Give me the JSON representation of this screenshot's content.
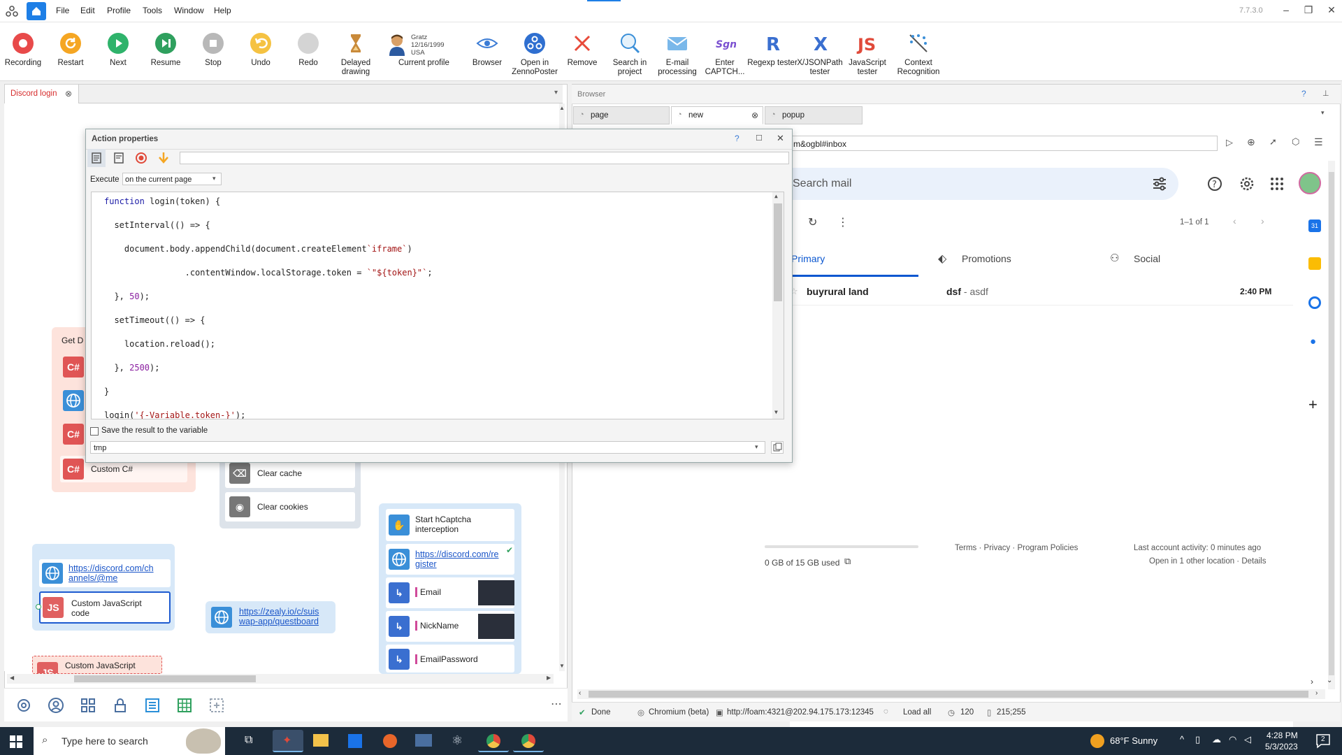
{
  "menu": {
    "file": "File",
    "edit": "Edit",
    "profile": "Profile",
    "tools": "Tools",
    "window": "Window",
    "help": "Help",
    "version": "7.7.3.0"
  },
  "toolbar": {
    "recording": "Recording",
    "restart": "Restart",
    "next": "Next",
    "resume": "Resume",
    "stop": "Stop",
    "undo": "Undo",
    "redo": "Redo",
    "delayed_drawing_1": "Delayed",
    "delayed_drawing_2": "drawing",
    "profile_name": "Gratz",
    "profile_date": "12/16/1999",
    "profile_country": "USA",
    "current_profile": "Current profile",
    "browser": "Browser",
    "open_zp_1": "Open in",
    "open_zp_2": "ZennoPoster",
    "remove": "Remove",
    "search_proj_1": "Search in",
    "search_proj_2": "project",
    "email_1": "E-mail",
    "email_2": "processing",
    "captcha_1": "Enter",
    "captcha_2": "CAPTCH...",
    "regexp": "Regexp tester",
    "xpath_1": "X/JSONPath",
    "xpath_2": "tester",
    "js_1": "JavaScript",
    "js_2": "tester",
    "context_1": "Context",
    "context_2": "Recognition"
  },
  "project_tab": {
    "label": "Discord login"
  },
  "dialog": {
    "title": "Action properties",
    "execute_label": "Execute",
    "execute_value": "on the current page",
    "save_label": "Save the result to the variable",
    "variable": "tmp"
  },
  "code": {
    "l1a": "function",
    "l1b": " login(token) {",
    "l2": "  setInterval(() => {",
    "l3a": "    document.body.appendChild(document.createElement",
    "l3b": "`iframe`",
    "l3c": ")",
    "l4a": "                .contentWindow.localStorage.token = ",
    "l4b": "`\"${token}\"`",
    "l4c": ";",
    "l5a": "  }, ",
    "l5b": "50",
    "l5c": ");",
    "l6": "  setTimeout(() => {",
    "l7": "    location.reload();",
    "l8a": "  }, ",
    "l8b": "2500",
    "l8c": ");",
    "l9": "}",
    "l10a": "login(",
    "l10b": "'{-Variable.token-}'",
    "l10c": ");"
  },
  "nodes": {
    "get_d": "Get D",
    "custom_cs": "Custom C#",
    "clear_cache": "Clear cache",
    "clear_cookies": "Clear cookies",
    "discord_me_1": "https://discord.com/ch",
    "discord_me_2": "annels/@me",
    "custom_js_1": "Custom JavaScript",
    "custom_js_2": "code",
    "zealy_1": "https://zealy.io/c/suis",
    "zealy_2": "wap-app/questboard",
    "custom_js_bottom": "Custom JavaScript",
    "hcaptcha_1": "Start hCaptcha",
    "hcaptcha_2": "interception",
    "discord_reg_1": "https://discord.com/re",
    "discord_reg_2": "gister",
    "email": "Email",
    "nickname": "NickName",
    "email_password": "EmailPassword",
    "cs": "C#",
    "js": "JS"
  },
  "browser": {
    "header": "Browser",
    "tab_page": "page",
    "tab_new": "new",
    "tab_popup": "popup",
    "url": "m&ogbl#inbox"
  },
  "gmail": {
    "search_placeholder": "Search mail",
    "pagination": "1–1 of 1",
    "tab_primary": "Primary",
    "tab_promotions": "Promotions",
    "tab_social": "Social",
    "sender": "buyrural land",
    "subject": "dsf",
    "snippet": " - asdf",
    "time": "2:40 PM",
    "storage": "0 GB of 15 GB used",
    "footer_links": "Terms · Privacy · Program Policies",
    "activity": "Last account activity: 0 minutes ago",
    "other_location": "Open in 1 other location · Details"
  },
  "status": {
    "done": "Done",
    "engine": "Chromium (beta)",
    "proxy": "http://foam:4321@202.94.175.173:12345",
    "load": "Load all",
    "timeout": "120",
    "size": "215;255"
  },
  "taskbar": {
    "search": "Type here to search",
    "weather": "68°F  Sunny",
    "time": "4:28 PM",
    "date": "5/3/2023",
    "notif": "2"
  },
  "colors": {
    "accent": "#1e7fe6",
    "cs_node": "#e05555",
    "web_node": "#3a8fd8",
    "gmail_blue": "#0b57d0"
  }
}
